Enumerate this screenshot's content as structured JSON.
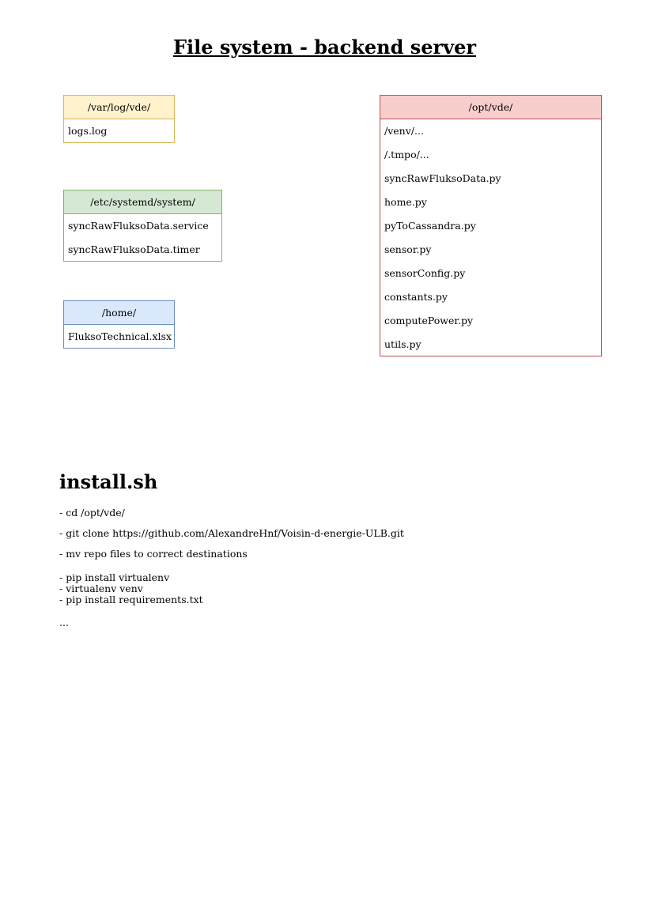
{
  "title": "File system - backend server",
  "folders": {
    "var_log": {
      "path": "/var/log/vde/",
      "files": [
        "logs.log"
      ],
      "header_color": "#fff2cc",
      "border_color": "#d6b656"
    },
    "systemd": {
      "path": "/etc/systemd/system/",
      "files": [
        "syncRawFluksoData.service",
        "syncRawFluksoData.timer"
      ],
      "header_color": "#d5e8d4",
      "border_color": "#82b366"
    },
    "home": {
      "path": "/home/",
      "files": [
        "FluksoTechnical.xlsx"
      ],
      "header_color": "#dae8fc",
      "border_color": "#6c8ebf"
    },
    "opt": {
      "path": "/opt/vde/",
      "files": [
        "/venv/...",
        "/.tmpo/...",
        "syncRawFluksoData.py",
        "home.py",
        "pyToCassandra.py",
        "sensor.py",
        "sensorConfig.py",
        "constants.py",
        "computePower.py",
        "utils.py"
      ],
      "header_color": "#f8cecc",
      "border_color": "#b85450"
    }
  },
  "install": {
    "title": "install.sh",
    "lines": [
      "- cd /opt/vde/",
      "- git clone https://github.com/AlexandreHnf/Voisin-d-energie-ULB.git",
      "- mv repo files to correct destinations",
      "- pip install virtualenv",
      "- virtualenv venv",
      "- pip install requirements.txt",
      "..."
    ]
  }
}
